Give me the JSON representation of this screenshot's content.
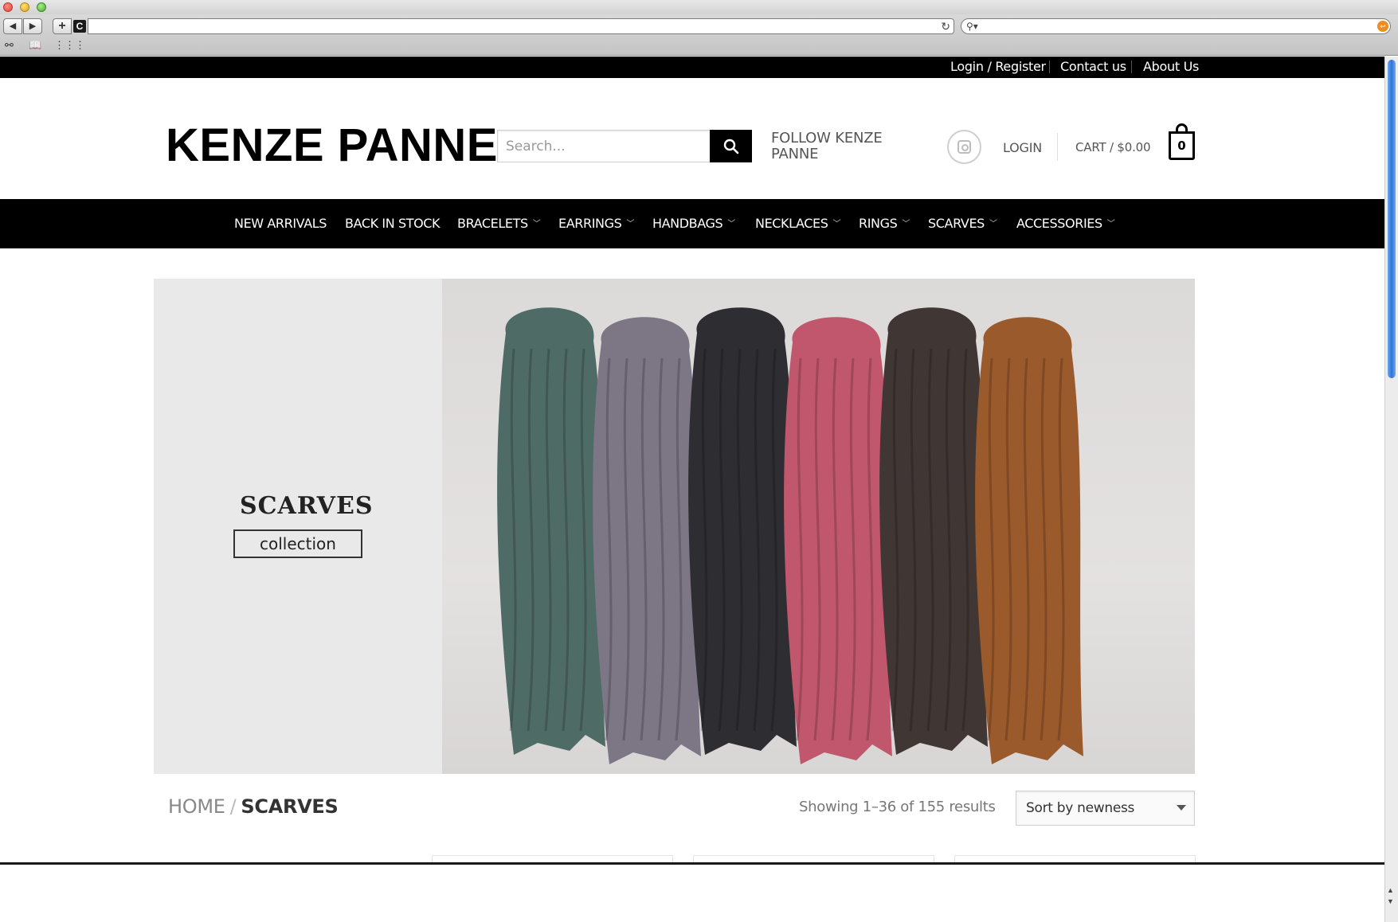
{
  "browser": {
    "back_icon": "back-arrow-icon",
    "forward_icon": "forward-arrow-icon",
    "new_tab_icon": "plus-icon",
    "reload_icon": "reload-icon",
    "search_icon": "magnifier-icon"
  },
  "topbar": {
    "links": [
      "Login / Register",
      "Contact us",
      "About Us"
    ]
  },
  "header": {
    "logo": "KENZE PANNE",
    "search_placeholder": "Search...",
    "follow_line1": "FOLLOW KENZE",
    "follow_line2": "PANNE",
    "login": "LOGIN",
    "cart": "CART / $0.00",
    "cart_count": "0"
  },
  "nav": {
    "items": [
      {
        "label": "NEW ARRIVALS",
        "dropdown": false
      },
      {
        "label": "BACK IN STOCK",
        "dropdown": false
      },
      {
        "label": "BRACELETS",
        "dropdown": true
      },
      {
        "label": "EARRINGS",
        "dropdown": true
      },
      {
        "label": "HANDBAGS",
        "dropdown": true
      },
      {
        "label": "NECKLACES",
        "dropdown": true
      },
      {
        "label": "RINGS",
        "dropdown": true
      },
      {
        "label": "SCARVES",
        "dropdown": true
      },
      {
        "label": "ACCESSORIES",
        "dropdown": true
      }
    ]
  },
  "banner": {
    "title": "SCARVES",
    "subtitle": "collection",
    "scarf_colors": [
      "#4f6b66",
      "#7c7685",
      "#2e2d31",
      "#c0576c",
      "#403634",
      "#9a5a2c"
    ]
  },
  "listing": {
    "breadcrumb_home": "HOME",
    "breadcrumb_sep": "/",
    "breadcrumb_current": "SCARVES",
    "results": "Showing 1–36 of 155 results",
    "sort_selected": "Sort by newness"
  }
}
